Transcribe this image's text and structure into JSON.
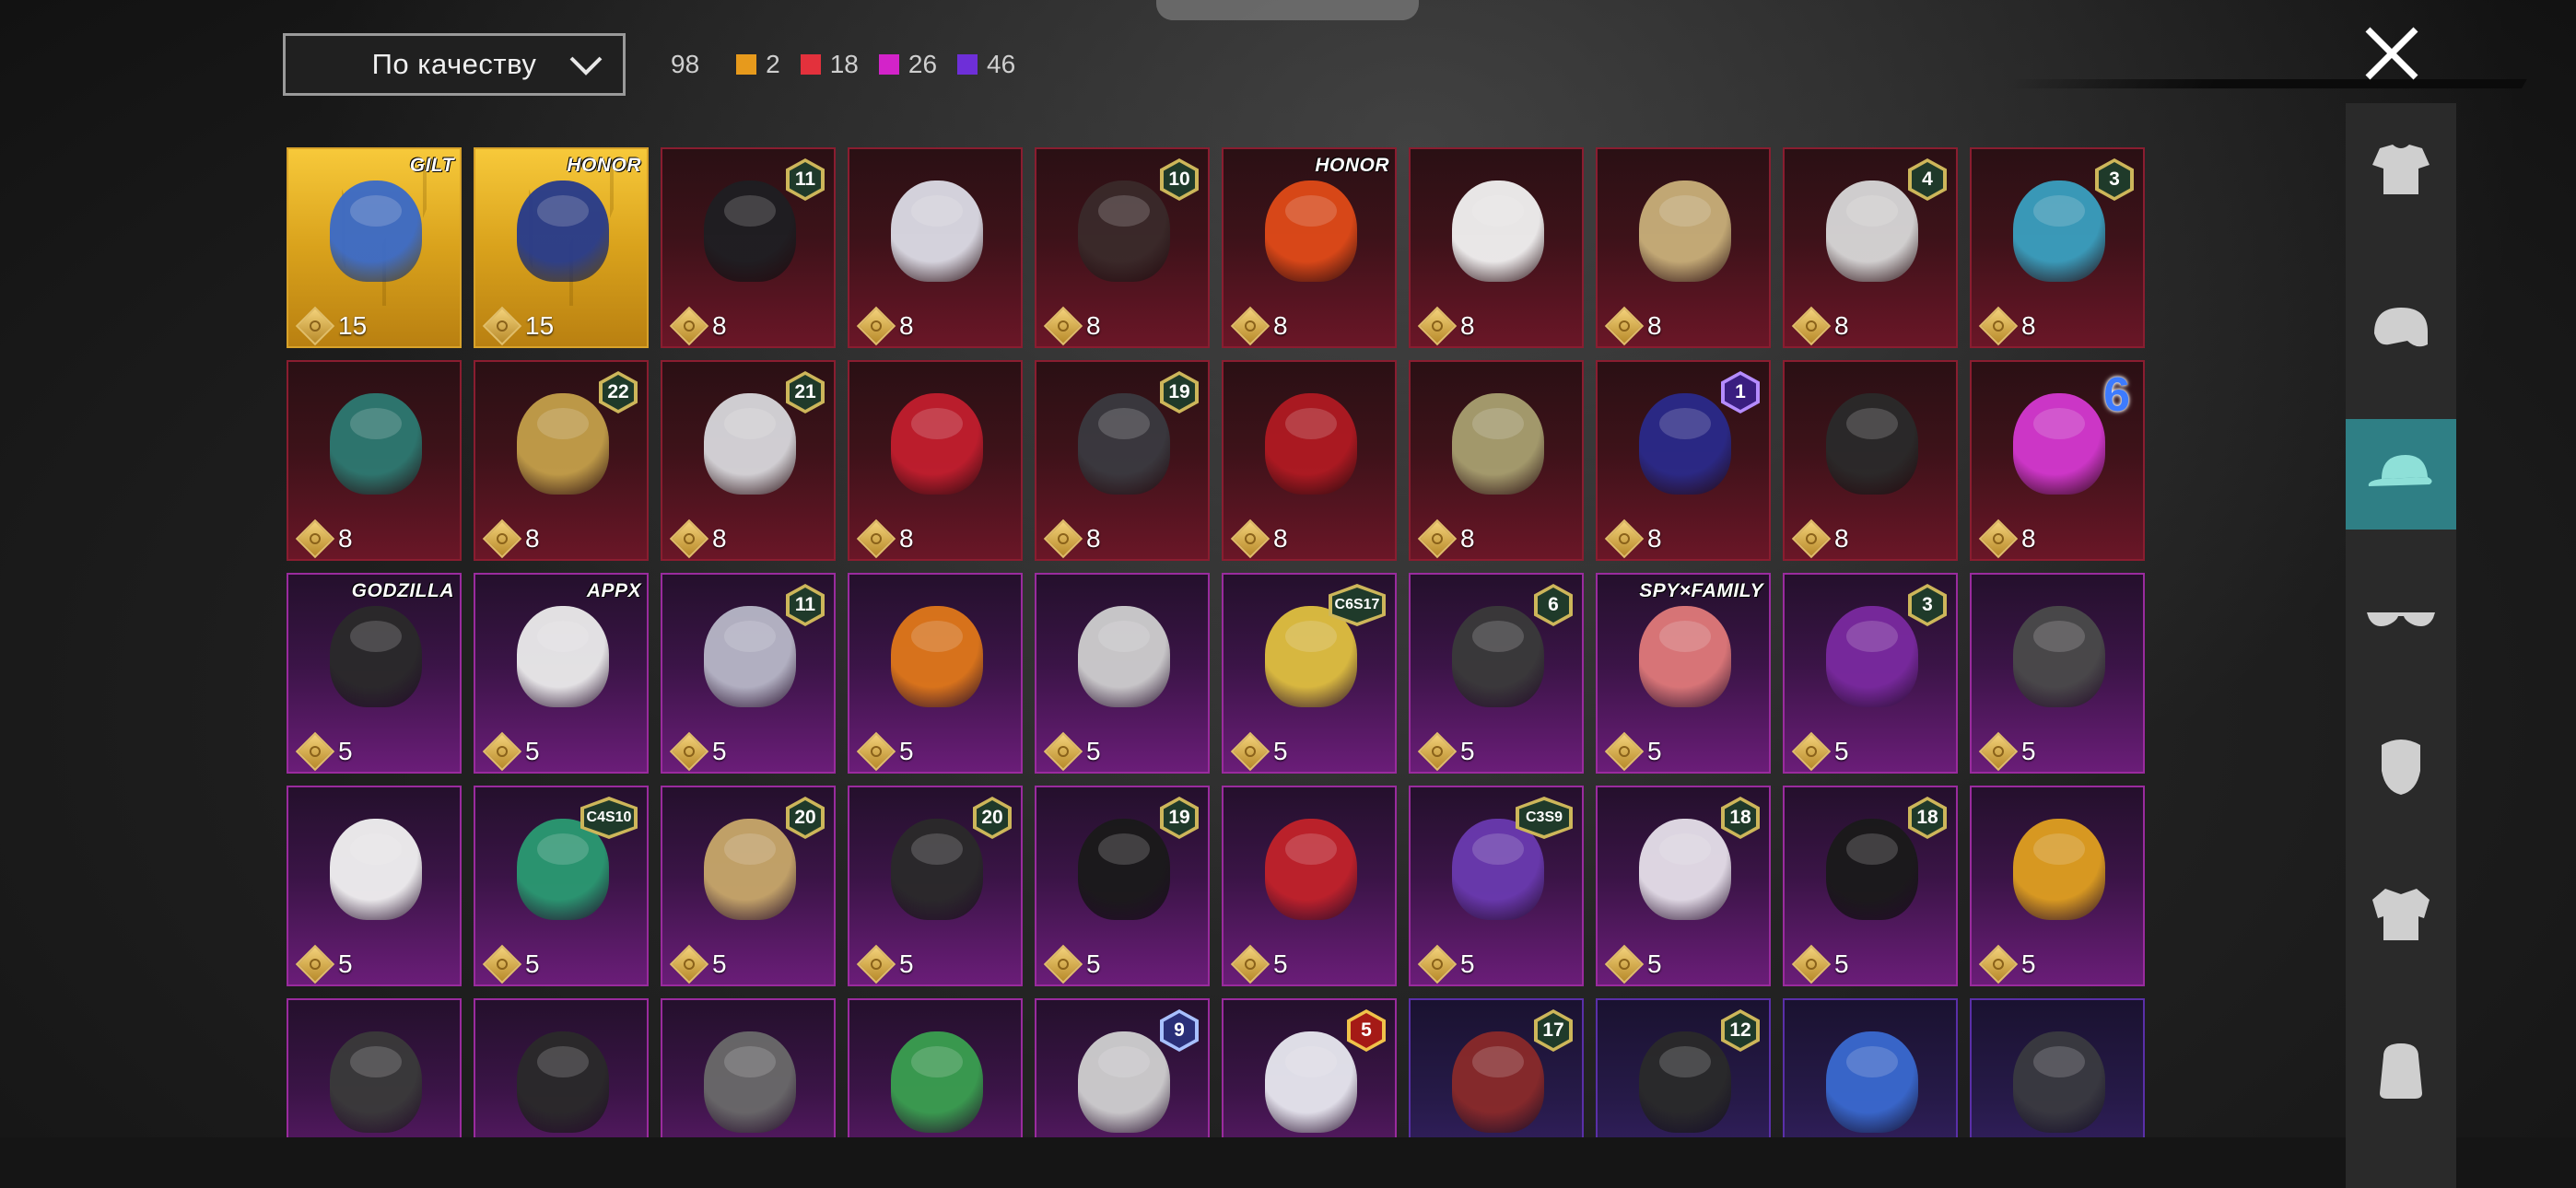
{
  "sort": {
    "label": "По качеству"
  },
  "counts": {
    "total": "98",
    "groups": [
      {
        "color": "#e79a1c",
        "value": "2"
      },
      {
        "color": "#e3313c",
        "value": "18"
      },
      {
        "color": "#d323c9",
        "value": "26"
      },
      {
        "color": "#6e2fd8",
        "value": "46"
      }
    ]
  },
  "items": [
    {
      "rarity": "gold",
      "price": "15",
      "badge": {
        "type": "brand",
        "text": "GILT"
      },
      "art": "#3a6ac8"
    },
    {
      "rarity": "gold",
      "price": "15",
      "badge": {
        "type": "brand",
        "text": "HONOR"
      },
      "art": "#263a8c"
    },
    {
      "rarity": "red",
      "price": "8",
      "badge": {
        "type": "hex",
        "text": "11",
        "style": ""
      },
      "art": "#1e1e22"
    },
    {
      "rarity": "red",
      "price": "8",
      "badge": null,
      "art": "#dcdce6"
    },
    {
      "rarity": "red",
      "price": "8",
      "badge": {
        "type": "hex",
        "text": "10",
        "style": ""
      },
      "art": "#3a2a2a"
    },
    {
      "rarity": "red",
      "price": "8",
      "badge": {
        "type": "brand",
        "text": "HONOR"
      },
      "art": "#e04a18"
    },
    {
      "rarity": "red",
      "price": "8",
      "badge": null,
      "art": "#f2f2f2"
    },
    {
      "rarity": "red",
      "price": "8",
      "badge": null,
      "art": "#c9b07a"
    },
    {
      "rarity": "red",
      "price": "8",
      "badge": {
        "type": "hex",
        "text": "4",
        "style": ""
      },
      "art": "#d8d8d8"
    },
    {
      "rarity": "red",
      "price": "8",
      "badge": {
        "type": "hex",
        "text": "3",
        "style": ""
      },
      "art": "#3aa0c0"
    },
    {
      "rarity": "red",
      "price": "8",
      "badge": null,
      "art": "#2d7a72"
    },
    {
      "rarity": "red",
      "price": "8",
      "badge": {
        "type": "hex",
        "text": "22",
        "style": ""
      },
      "art": "#c4a04a"
    },
    {
      "rarity": "red",
      "price": "8",
      "badge": {
        "type": "hex",
        "text": "21",
        "style": ""
      },
      "art": "#d8d8dc"
    },
    {
      "rarity": "red",
      "price": "8",
      "badge": null,
      "art": "#c21e2e"
    },
    {
      "rarity": "red",
      "price": "8",
      "badge": {
        "type": "hex",
        "text": "19",
        "style": ""
      },
      "art": "#3a3a40"
    },
    {
      "rarity": "red",
      "price": "8",
      "badge": null,
      "art": "#b01a22"
    },
    {
      "rarity": "red",
      "price": "8",
      "badge": null,
      "art": "#a8a070"
    },
    {
      "rarity": "red",
      "price": "8",
      "badge": {
        "type": "hex",
        "text": "1",
        "style": "purple"
      },
      "art": "#2a2a8a"
    },
    {
      "rarity": "red",
      "price": "8",
      "badge": null,
      "art": "#2a2a2a"
    },
    {
      "rarity": "red",
      "price": "8",
      "badge": {
        "type": "num",
        "text": "6"
      },
      "art": "#d438d0"
    },
    {
      "rarity": "purple",
      "price": "5",
      "badge": {
        "type": "brand",
        "text": "GODZILLA"
      },
      "art": "#2a2a2a"
    },
    {
      "rarity": "purple",
      "price": "5",
      "badge": {
        "type": "brand",
        "text": "APPX"
      },
      "art": "#ececec"
    },
    {
      "rarity": "purple",
      "price": "5",
      "badge": {
        "type": "hex",
        "text": "11",
        "style": ""
      },
      "art": "#b8b8c8"
    },
    {
      "rarity": "purple",
      "price": "5",
      "badge": null,
      "art": "#e0781a"
    },
    {
      "rarity": "purple",
      "price": "5",
      "badge": null,
      "art": "#cfcfcf"
    },
    {
      "rarity": "purple",
      "price": "5",
      "badge": {
        "type": "hex",
        "text": "C6S17",
        "style": "wide"
      },
      "art": "#e0c040"
    },
    {
      "rarity": "purple",
      "price": "5",
      "badge": {
        "type": "hex",
        "text": "6",
        "style": ""
      },
      "art": "#3a3a3a"
    },
    {
      "rarity": "purple",
      "price": "5",
      "badge": {
        "type": "brand",
        "text": "SPY×FAMILY"
      },
      "art": "#e07a7a"
    },
    {
      "rarity": "purple",
      "price": "5",
      "badge": {
        "type": "hex",
        "text": "3",
        "style": ""
      },
      "art": "#7a2aa0"
    },
    {
      "rarity": "purple",
      "price": "5",
      "badge": null,
      "art": "#4a4a4a"
    },
    {
      "rarity": "purple",
      "price": "5",
      "badge": null,
      "art": "#f2f2f2"
    },
    {
      "rarity": "purple",
      "price": "5",
      "badge": {
        "type": "hex",
        "text": "C4S10",
        "style": "wide"
      },
      "art": "#2a9a72"
    },
    {
      "rarity": "purple",
      "price": "5",
      "badge": {
        "type": "hex",
        "text": "20",
        "style": ""
      },
      "art": "#c8a86a"
    },
    {
      "rarity": "purple",
      "price": "5",
      "badge": {
        "type": "hex",
        "text": "20",
        "style": ""
      },
      "art": "#2a2a2a"
    },
    {
      "rarity": "purple",
      "price": "5",
      "badge": {
        "type": "hex",
        "text": "19",
        "style": ""
      },
      "art": "#1a1a1a"
    },
    {
      "rarity": "purple",
      "price": "5",
      "badge": null,
      "art": "#c2222a"
    },
    {
      "rarity": "purple",
      "price": "5",
      "badge": {
        "type": "hex",
        "text": "C3S9",
        "style": "wide"
      },
      "art": "#6a3ab0"
    },
    {
      "rarity": "purple",
      "price": "5",
      "badge": {
        "type": "hex",
        "text": "18",
        "style": ""
      },
      "art": "#e6e0ea"
    },
    {
      "rarity": "purple",
      "price": "5",
      "badge": {
        "type": "hex",
        "text": "18",
        "style": ""
      },
      "art": "#1a1a1a"
    },
    {
      "rarity": "purple",
      "price": "5",
      "badge": null,
      "art": "#e0a020"
    },
    {
      "rarity": "purple",
      "price": "",
      "badge": null,
      "art": "#3a3a3a"
    },
    {
      "rarity": "purple",
      "price": "",
      "badge": null,
      "art": "#2a2a2a"
    },
    {
      "rarity": "purple",
      "price": "",
      "badge": null,
      "art": "#6a6a6a"
    },
    {
      "rarity": "purple",
      "price": "",
      "badge": null,
      "art": "#3aa050"
    },
    {
      "rarity": "purple",
      "price": "",
      "badge": {
        "type": "hex",
        "text": "9",
        "style": "blue"
      },
      "art": "#d0d0d0"
    },
    {
      "rarity": "purple",
      "price": "",
      "badge": {
        "type": "hex",
        "text": "5",
        "style": "red"
      },
      "art": "#e8e8f0"
    },
    {
      "rarity": "violet",
      "price": "",
      "badge": {
        "type": "hex",
        "text": "17",
        "style": ""
      },
      "art": "#8a2a2a"
    },
    {
      "rarity": "violet",
      "price": "",
      "badge": {
        "type": "hex",
        "text": "12",
        "style": ""
      },
      "art": "#2a2a2a"
    },
    {
      "rarity": "violet",
      "price": "",
      "badge": null,
      "art": "#3a6ad0"
    },
    {
      "rarity": "violet",
      "price": "",
      "badge": null,
      "art": "#3a3a40"
    }
  ],
  "sidebar": [
    {
      "name": "outfit-icon",
      "active": false
    },
    {
      "name": "helmet-icon",
      "active": false
    },
    {
      "name": "cap-icon",
      "active": true
    },
    {
      "name": "glasses-icon",
      "active": false
    },
    {
      "name": "mask-icon",
      "active": false
    },
    {
      "name": "jacket-icon",
      "active": false
    },
    {
      "name": "backpack-icon",
      "active": false
    }
  ]
}
